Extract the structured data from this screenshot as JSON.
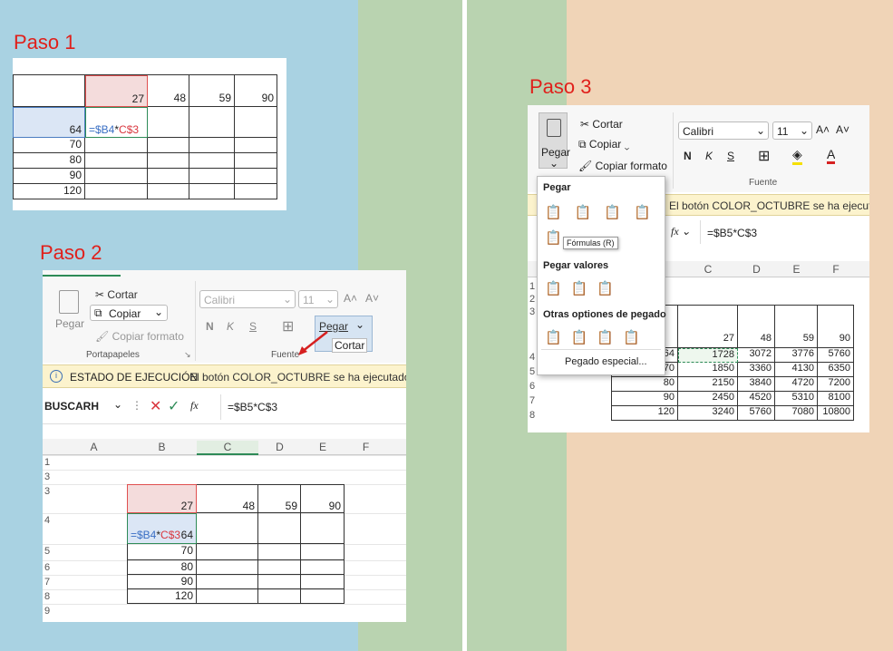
{
  "colors": {
    "left_bg": "#a9d2e2",
    "mid_bg": "#b9d3b0",
    "right_bg": "#f0d4b7",
    "title": "#e0201b",
    "selected": "#f4dcdc",
    "selected_blue": "#dbe6f5",
    "banner": "#fcf3cd"
  },
  "step1": {
    "title": "Paso 1",
    "col_values": [
      "27",
      "48",
      "59",
      "90"
    ],
    "row_values": [
      "64",
      "70",
      "80",
      "90",
      "120"
    ],
    "formula_parts": [
      "=$B4",
      "*",
      "C$3"
    ]
  },
  "step2": {
    "title": "Paso 2",
    "ribbon": {
      "paste": "Pegar",
      "cut": "Cortar",
      "copy": "Copiar",
      "format_painter": "Copiar formato",
      "group_portapapeles": "Portapapeles",
      "font_name": "Calibri",
      "font_size": "11",
      "bold": "N",
      "italic": "K",
      "underline": "S",
      "group_fuente": "Fuente",
      "tooltip_paste": "Pegar",
      "tooltip_cut": "Cortar"
    },
    "banner": {
      "label": "ESTADO DE EJECUCIÓN",
      "message": "El botón COLOR_OCTUBRE se ha ejecutado corre"
    },
    "namebox": "BUSCARH",
    "fx": "fx",
    "formula": "=$B5*C$3",
    "columns": [
      "A",
      "B",
      "C",
      "D",
      "E",
      "F"
    ],
    "rows": [
      "1",
      "3",
      "3",
      "4",
      "5",
      "6",
      "7",
      "8",
      "9"
    ],
    "col_values": [
      "27",
      "48",
      "59",
      "90"
    ],
    "row_values": [
      "64",
      "70",
      "80",
      "90",
      "120"
    ],
    "formula_parts": [
      "=$B4",
      "*",
      "C$3"
    ]
  },
  "step3": {
    "title": "Paso 3",
    "ribbon": {
      "paste": "Pegar",
      "cut": "Cortar",
      "copy": "Copiar",
      "format_painter": "Copiar formato",
      "font_name": "Calibri",
      "font_size": "11",
      "bold": "N",
      "italic": "K",
      "underline": "S",
      "group_fuente": "Fuente"
    },
    "menu": {
      "header": "Pegar",
      "tooltip": "Fórmulas (R)",
      "values_header": "Pegar valores",
      "other_header": "Otras optiones de pegado",
      "special": "Pegado especial..."
    },
    "banner_message": "El botón COLOR_OCTUBRE se ha ejecutado corre",
    "fx": "fx",
    "formula": "=$B5*C$3",
    "columns": [
      "C",
      "D",
      "E",
      "F"
    ],
    "rows": [
      "1",
      "2",
      "3",
      "4",
      "5",
      "6",
      "7",
      "8"
    ],
    "header_values": [
      "27",
      "48",
      "59",
      "90"
    ],
    "row_labels": [
      "64",
      "70",
      "80",
      "90",
      "120"
    ],
    "table": [
      [
        "1728",
        "3072",
        "3776",
        "5760"
      ],
      [
        "1850",
        "3360",
        "4130",
        "6350"
      ],
      [
        "2150",
        "3840",
        "4720",
        "7200"
      ],
      [
        "2450",
        "4520",
        "5310",
        "8100"
      ],
      [
        "3240",
        "5760",
        "7080",
        "10800"
      ]
    ]
  }
}
